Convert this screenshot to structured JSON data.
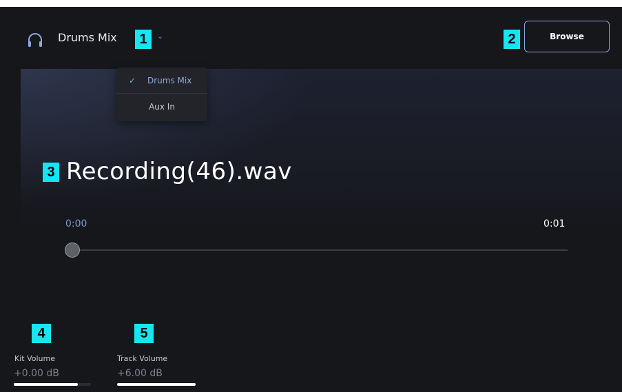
{
  "header": {
    "source_label": "Drums Mix",
    "browse_label": "Browse"
  },
  "dropdown": {
    "options": [
      {
        "label": "Drums Mix",
        "selected": true
      },
      {
        "label": "Aux In",
        "selected": false
      }
    ]
  },
  "player": {
    "file_name": "Recording(46).wav",
    "time_current": "0:00",
    "time_total": "0:01",
    "position_fraction": 0.0
  },
  "kit_volume": {
    "label": "Kit Volume",
    "value": "+0.00 dB",
    "level_fraction": 0.83
  },
  "track_volume": {
    "label": "Track Volume",
    "value": "+6.00 dB",
    "level_fraction": 1.0
  },
  "annotations": {
    "badge_1": "1",
    "badge_2": "2",
    "badge_3": "3",
    "badge_4": "4",
    "badge_5": "5"
  },
  "colors": {
    "background": "#16171b",
    "accent": "#8fa7e0",
    "badge": "#17e6f2"
  },
  "icons": {
    "headphones": "headphones-icon",
    "chevron": "chevron-down-icon",
    "check": "check-icon"
  }
}
